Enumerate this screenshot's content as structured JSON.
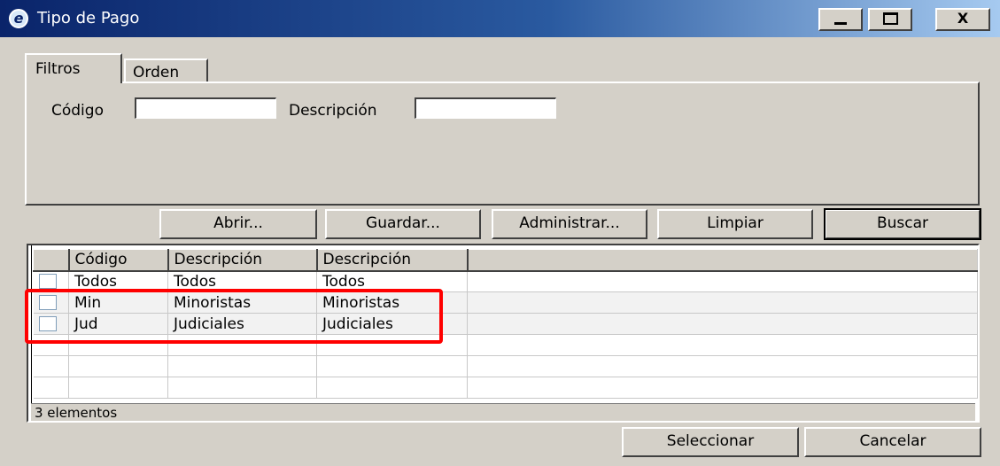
{
  "window": {
    "title": "Tipo de Pago",
    "app_icon": "app-logo-icon",
    "minimize": "_",
    "maximize": "□",
    "close": "X"
  },
  "tabs": [
    {
      "label": "Filtros",
      "selected": true
    },
    {
      "label": "Orden",
      "selected": false
    }
  ],
  "filters": {
    "codigo_label": "Código",
    "codigo_value": "",
    "descripcion_label": "Descripción",
    "descripcion_value": ""
  },
  "toolbar": {
    "abrir": "Abrir...",
    "guardar": "Guardar...",
    "administrar": "Administrar...",
    "limpiar": "Limpiar",
    "buscar": "Buscar"
  },
  "grid": {
    "columns": [
      "",
      "Código",
      "Descripción",
      "Descripción",
      ""
    ],
    "rows": [
      {
        "checked": false,
        "codigo": "Todos",
        "descripcion1": "Todos",
        "descripcion2": "Todos"
      },
      {
        "checked": false,
        "codigo": "Min",
        "descripcion1": "Minoristas",
        "descripcion2": "Minoristas"
      },
      {
        "checked": false,
        "codigo": "Jud",
        "descripcion1": "Judiciales",
        "descripcion2": "Judiciales"
      }
    ],
    "status": "3 elementos"
  },
  "footer": {
    "seleccionar": "Seleccionar",
    "cancelar": "Cancelar"
  },
  "colors": {
    "window_bg": "#d4d0c8",
    "titlebar_start": "#0a246a",
    "titlebar_end": "#a6caf0",
    "highlight": "#ff0000"
  }
}
